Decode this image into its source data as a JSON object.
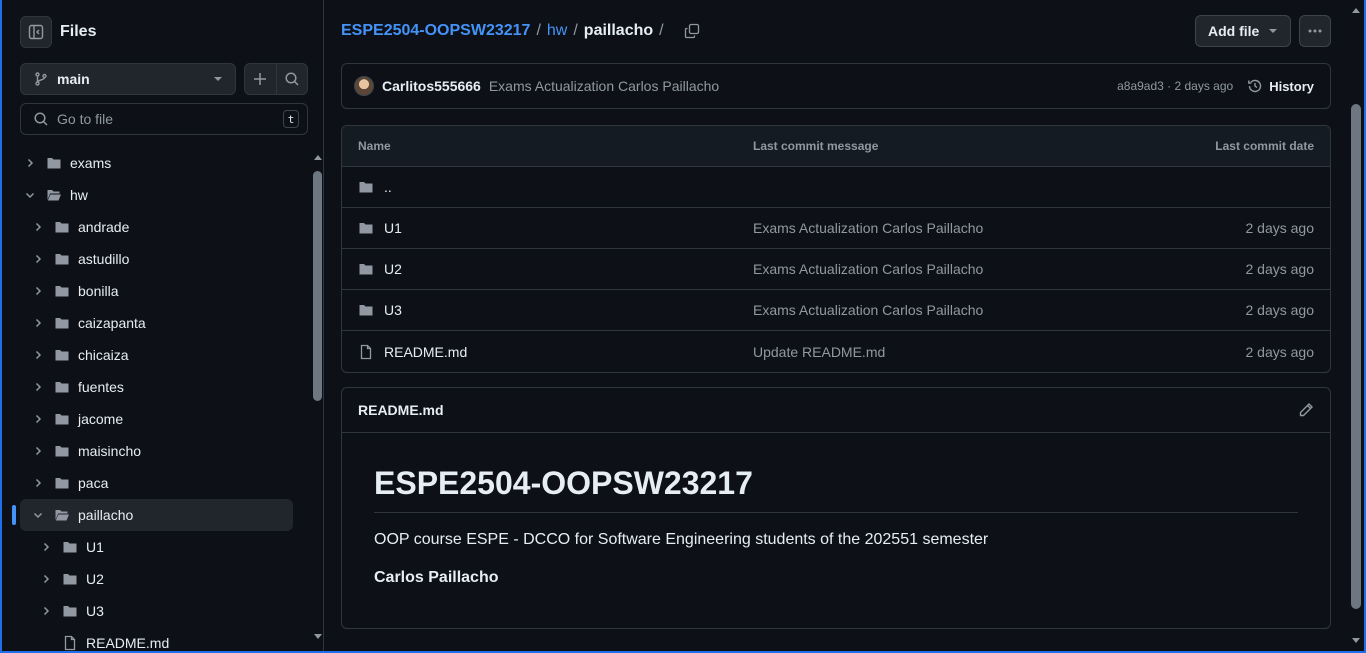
{
  "sidebar": {
    "title": "Files",
    "branch": "main",
    "goto_placeholder": "Go to file",
    "goto_shortcut": "t",
    "tree": [
      {
        "label": "exams",
        "level": 0,
        "type": "folder",
        "expanded": false
      },
      {
        "label": "hw",
        "level": 0,
        "type": "folder",
        "expanded": true
      },
      {
        "label": "andrade",
        "level": 1,
        "type": "folder",
        "expanded": false
      },
      {
        "label": "astudillo",
        "level": 1,
        "type": "folder",
        "expanded": false
      },
      {
        "label": "bonilla",
        "level": 1,
        "type": "folder",
        "expanded": false
      },
      {
        "label": "caizapanta",
        "level": 1,
        "type": "folder",
        "expanded": false
      },
      {
        "label": "chicaiza",
        "level": 1,
        "type": "folder",
        "expanded": false
      },
      {
        "label": "fuentes",
        "level": 1,
        "type": "folder",
        "expanded": false
      },
      {
        "label": "jacome",
        "level": 1,
        "type": "folder",
        "expanded": false
      },
      {
        "label": "maisincho",
        "level": 1,
        "type": "folder",
        "expanded": false
      },
      {
        "label": "paca",
        "level": 1,
        "type": "folder",
        "expanded": false
      },
      {
        "label": "paillacho",
        "level": 1,
        "type": "folder",
        "expanded": true,
        "active": true
      },
      {
        "label": "U1",
        "level": 2,
        "type": "folder",
        "expanded": false
      },
      {
        "label": "U2",
        "level": 2,
        "type": "folder",
        "expanded": false
      },
      {
        "label": "U3",
        "level": 2,
        "type": "folder",
        "expanded": false
      },
      {
        "label": "README.md",
        "level": 2,
        "type": "file"
      }
    ]
  },
  "breadcrumb": {
    "repo": "ESPE2504-OOPSW23217",
    "sep": "/",
    "dir": "hw",
    "current": "paillacho"
  },
  "toolbar": {
    "add_file": "Add file"
  },
  "commit": {
    "author": "Carlitos555666",
    "message": "Exams Actualization Carlos Paillacho",
    "hash_age": "a8a9ad3 · 2 days ago",
    "history": "History"
  },
  "table": {
    "headers": {
      "name": "Name",
      "message": "Last commit message",
      "date": "Last commit date"
    },
    "parent": "..",
    "rows": [
      {
        "name": "U1",
        "type": "folder",
        "message": "Exams Actualization Carlos Paillacho",
        "date": "2 days ago"
      },
      {
        "name": "U2",
        "type": "folder",
        "message": "Exams Actualization Carlos Paillacho",
        "date": "2 days ago"
      },
      {
        "name": "U3",
        "type": "folder",
        "message": "Exams Actualization Carlos Paillacho",
        "date": "2 days ago"
      },
      {
        "name": "README.md",
        "type": "file",
        "message": "Update README.md",
        "date": "2 days ago"
      }
    ]
  },
  "readme": {
    "file": "README.md",
    "heading": "ESPE2504-OOPSW23217",
    "paragraph": "OOP course ESPE - DCCO for Software Engineering students of the 202551 semester",
    "author": "Carlos Paillacho"
  },
  "colors": {
    "background": "#0d1117",
    "border": "#30363d",
    "link": "#4493f8",
    "muted": "#9198a1",
    "text": "#e6edf3"
  }
}
